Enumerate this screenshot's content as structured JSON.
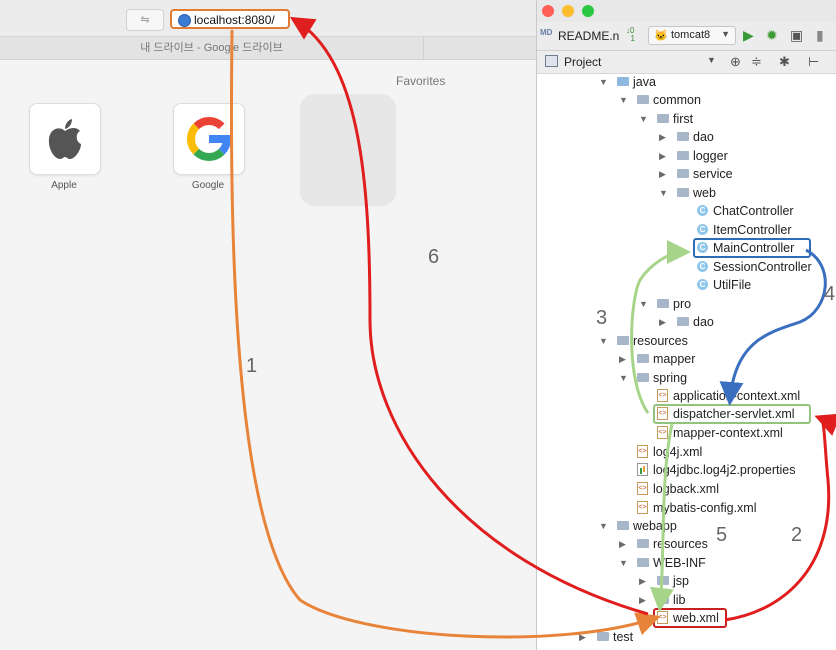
{
  "browser": {
    "reader_button_label": "⇋",
    "url": "localhost:8080/",
    "tab_title": "내 드라이브 - Google 드라이브",
    "favorites_title": "Favorites",
    "favorites": [
      {
        "label": "Apple",
        "icon": "apple-logo-icon"
      },
      {
        "label": "Google",
        "icon": "google-logo-icon"
      }
    ]
  },
  "ide": {
    "file_tab": "README.n",
    "run_config": "tomcat8",
    "panel_title": "Project",
    "colors": {
      "close": "#ff5f57",
      "minimize": "#febc2e",
      "maximize": "#28c840",
      "run": "#3a9a3a",
      "debug": "#3d9b35"
    },
    "tree": [
      {
        "label": "java",
        "icon": "source-folder",
        "arrow": "open"
      },
      {
        "label": "common",
        "icon": "folder",
        "arrow": "open"
      },
      {
        "label": "first",
        "icon": "folder",
        "arrow": "open"
      },
      {
        "label": "dao",
        "icon": "folder",
        "arrow": "closed"
      },
      {
        "label": "logger",
        "icon": "folder",
        "arrow": "closed"
      },
      {
        "label": "service",
        "icon": "folder",
        "arrow": "closed"
      },
      {
        "label": "web",
        "icon": "folder",
        "arrow": "open"
      },
      {
        "label": "ChatController",
        "icon": "class"
      },
      {
        "label": "ItemController",
        "icon": "class"
      },
      {
        "label": "MainController",
        "icon": "class"
      },
      {
        "label": "SessionController",
        "icon": "class"
      },
      {
        "label": "UtilFile",
        "icon": "class"
      },
      {
        "label": "pro",
        "icon": "folder",
        "arrow": "open"
      },
      {
        "label": "dao",
        "icon": "folder",
        "arrow": "closed"
      },
      {
        "label": "resources",
        "icon": "folder",
        "arrow": "open"
      },
      {
        "label": "mapper",
        "icon": "folder",
        "arrow": "closed"
      },
      {
        "label": "spring",
        "icon": "folder",
        "arrow": "open"
      },
      {
        "label": "application-context.xml",
        "icon": "xml"
      },
      {
        "label": "dispatcher-servlet.xml",
        "icon": "xml"
      },
      {
        "label": "mapper-context.xml",
        "icon": "xml"
      },
      {
        "label": "log4j.xml",
        "icon": "xml"
      },
      {
        "label": "log4jdbc.log4j2.properties",
        "icon": "properties"
      },
      {
        "label": "logback.xml",
        "icon": "xml"
      },
      {
        "label": "mybatis-config.xml",
        "icon": "xml"
      },
      {
        "label": "webapp",
        "icon": "folder",
        "arrow": "open"
      },
      {
        "label": "resources",
        "icon": "folder",
        "arrow": "closed"
      },
      {
        "label": "WEB-INF",
        "icon": "folder",
        "arrow": "open"
      },
      {
        "label": "jsp",
        "icon": "folder",
        "arrow": "closed"
      },
      {
        "label": "lib",
        "icon": "folder",
        "arrow": "closed"
      },
      {
        "label": "web.xml",
        "icon": "xml"
      },
      {
        "label": "test",
        "icon": "folder",
        "arrow": "closed"
      }
    ]
  },
  "annotations": {
    "steps": [
      "1",
      "2",
      "3",
      "4",
      "5",
      "6"
    ],
    "colors": {
      "orange": "#e8843a",
      "red": "#e01e1e",
      "green": "#a6d58a",
      "blue": "#3a6fc0",
      "url_box": "#e07b32",
      "main_controller_box": "#2e6db5",
      "dispatcher_box": "#93c47d",
      "web_xml_box": "#c82020"
    }
  }
}
